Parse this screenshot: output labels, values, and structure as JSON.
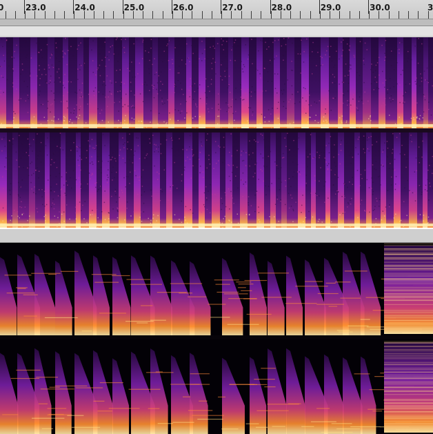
{
  "window": {
    "app": "audio-editor-spectrogram-view"
  },
  "ruler": {
    "partial_left_label": "0",
    "partial_right_label": "3",
    "ticks": [
      "23.0",
      "24.0",
      "25.0",
      "26.0",
      "27.0",
      "28.0",
      "29.0",
      "30.0"
    ]
  },
  "tracks": [
    {
      "id": "track-1",
      "view": "spectrogram",
      "channels": 2,
      "colormap": "magma-purple",
      "pattern": "vertical-transients"
    },
    {
      "id": "track-2",
      "view": "spectrogram",
      "channels": 2,
      "colormap": "magma-purple",
      "pattern": "harmonic-decays"
    }
  ],
  "colors": {
    "ruler_bg": "#d0d0d0",
    "spectrogram_low": "#000000",
    "spectrogram_mid": "#7a1fb0",
    "spectrogram_high": "#ff9a2e",
    "spectrogram_peak": "#fff6c8"
  }
}
